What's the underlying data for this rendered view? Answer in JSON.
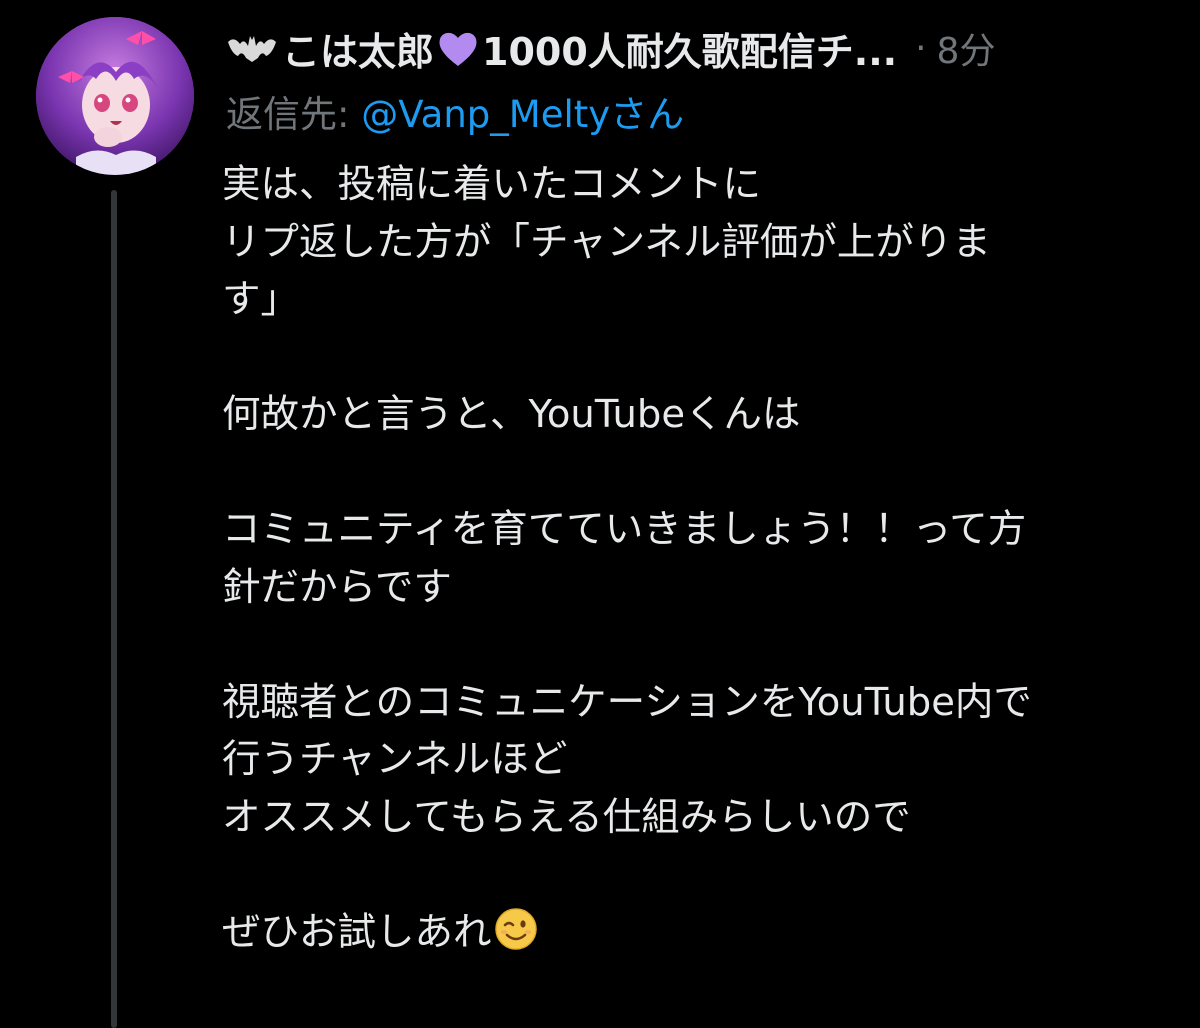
{
  "tweet": {
    "author": {
      "name_part1": "こは太郎",
      "name_part2": "1000人耐久歌配信チ...",
      "avatar_icon": "avatar-image",
      "prefix_icon": "bat-icon",
      "heart_icon": "purple-heart-icon"
    },
    "separator": "·",
    "time": "8分",
    "reply_to": {
      "prefix": "返信先: ",
      "handle": "@Vanp_Meltyさん"
    },
    "body_lines": [
      "実は、投稿に着いたコメントに",
      "リプ返した方が「チャンネル評価が上がりま",
      "す」",
      "",
      "何故かと言うと、YouTubeくんは",
      "",
      "コミュニティを育てていきましょう！！って方",
      "針だからです",
      "",
      "視聴者とのコミュニケーションをYouTube内で",
      "行うチャンネルほど",
      "オススメしてもらえる仕組みらしいので",
      "",
      "ぜひお試しあれ"
    ],
    "end_emoji": "winking-face-icon"
  },
  "colors": {
    "background": "#000000",
    "text": "#e7e9ea",
    "muted": "#71767b",
    "link": "#1d9bf0",
    "thread_line": "#333639",
    "heart": "#b38bf0"
  }
}
